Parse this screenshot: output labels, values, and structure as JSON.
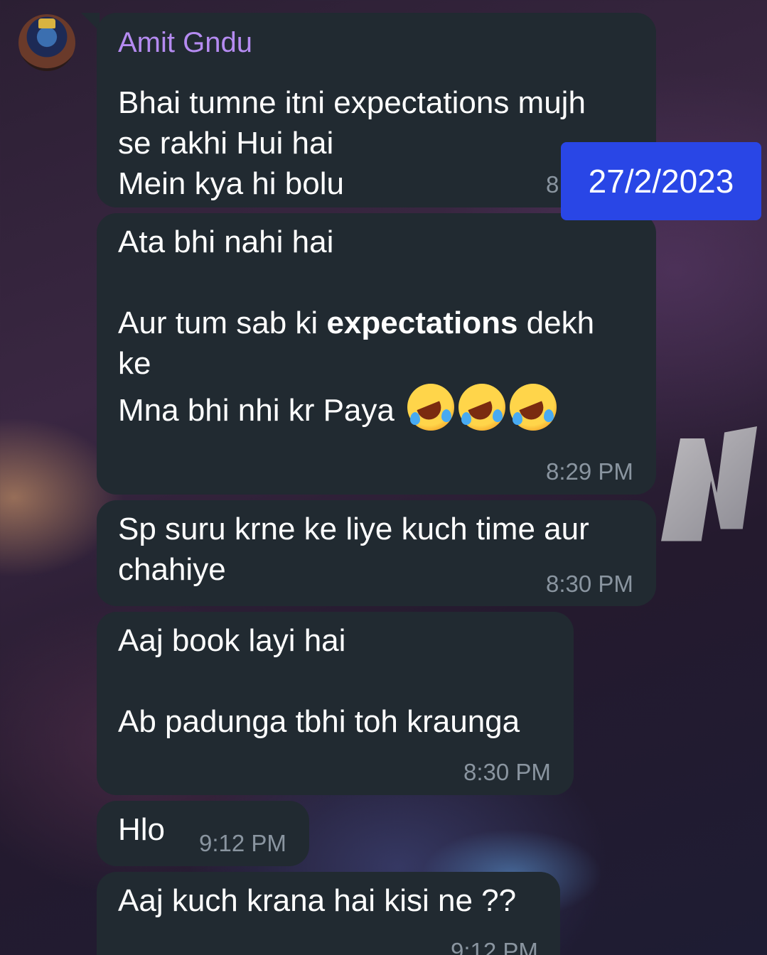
{
  "colors": {
    "bubble": "#212a31",
    "sender_name": "#b58bf1",
    "timestamp": "#8a95a0",
    "date_badge": "#2946e6"
  },
  "sender": {
    "name": "Amit Gndu",
    "avatar_icon": "krishna-avatar-icon"
  },
  "date_badge": "27/2/2023",
  "messages": [
    {
      "text": "Bhai tumne itni expectations mujh\nse rakhi Hui hai\nMein kya hi bolu",
      "time": "8"
    },
    {
      "line1": "Ata bhi nahi hai",
      "line2_pre": "Aur tum sab ki ",
      "line2_bold": "expectations",
      "line2_post": " dekh\nke",
      "line3": "Mna bhi nhi kr Paya",
      "emoji_icon": "rolling-on-floor-laughing-icon",
      "time": "8:29 PM"
    },
    {
      "text": "Sp suru krne ke liye kuch time aur\nchahiye",
      "time": "8:30 PM"
    },
    {
      "text": "Aaj book layi hai\n\nAb padunga tbhi toh kraunga",
      "time": "8:30 PM"
    },
    {
      "text": "Hlo",
      "time": "9:12 PM"
    },
    {
      "text": "Aaj kuch krana hai kisi ne ??",
      "time": "9:12 PM"
    }
  ]
}
